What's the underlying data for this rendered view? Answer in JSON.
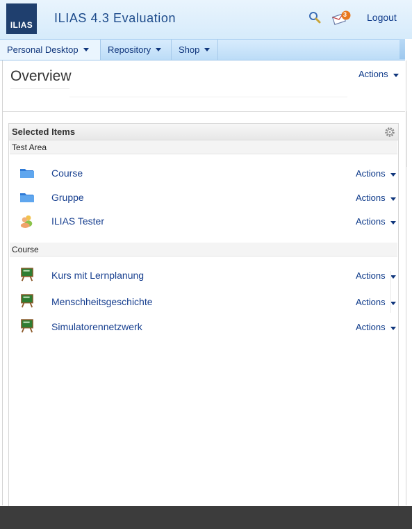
{
  "header": {
    "logo_text": "ILIAS",
    "title": "ILIAS 4.3 Evaluation",
    "mail_count": "3",
    "logout_label": "Logout"
  },
  "nav": {
    "items": [
      {
        "label": "Personal Desktop"
      },
      {
        "label": "Repository"
      },
      {
        "label": "Shop"
      }
    ]
  },
  "page": {
    "title": "Overview",
    "actions_label": "Actions"
  },
  "selected_items": {
    "title": "Selected Items",
    "groups": [
      {
        "name": "Test Area",
        "items": [
          {
            "label": "Course",
            "icon": "folder-icon",
            "actions": "Actions"
          },
          {
            "label": "Gruppe",
            "icon": "folder-icon",
            "actions": "Actions"
          },
          {
            "label": "ILIAS Tester",
            "icon": "users-icon",
            "actions": "Actions"
          }
        ]
      },
      {
        "name": "Course",
        "items": [
          {
            "label": "Kurs mit Lernplanung",
            "icon": "blackboard-icon",
            "actions": "Actions"
          },
          {
            "label": "Menschheitsgeschichte",
            "icon": "blackboard-icon",
            "actions": "Actions"
          },
          {
            "label": "Simulatorennetzwerk",
            "icon": "blackboard-icon",
            "actions": "Actions"
          }
        ]
      }
    ]
  },
  "colors": {
    "link": "#173f8f",
    "header_bg": "#d6ebfb",
    "logo_bg": "#1f3f6e",
    "badge": "#e8781e"
  }
}
